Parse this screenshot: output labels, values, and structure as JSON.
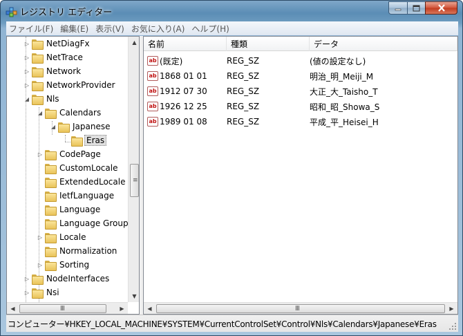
{
  "window": {
    "title": "レジストリ エディター"
  },
  "menu": [
    {
      "label": "ファイル(F)"
    },
    {
      "label": "編集(E)"
    },
    {
      "label": "表示(V)"
    },
    {
      "label": "お気に入り(A)"
    },
    {
      "label": "ヘルプ(H)"
    }
  ],
  "tree": {
    "items": [
      {
        "label": "NetDiagFx",
        "expanded": false
      },
      {
        "label": "NetTrace",
        "expanded": false
      },
      {
        "label": "Network",
        "expanded": false
      },
      {
        "label": "NetworkProvider",
        "expanded": false
      },
      {
        "label": "Nls",
        "expanded": true
      },
      {
        "label": "Calendars",
        "expanded": true
      },
      {
        "label": "Japanese",
        "expanded": true
      },
      {
        "label": "Eras",
        "selected": true
      },
      {
        "label": "CodePage",
        "expanded": false
      },
      {
        "label": "CustomLocale"
      },
      {
        "label": "ExtendedLocale"
      },
      {
        "label": "IetfLanguage"
      },
      {
        "label": "Language"
      },
      {
        "label": "Language Group"
      },
      {
        "label": "Locale",
        "expanded": false
      },
      {
        "label": "Normalization"
      },
      {
        "label": "Sorting",
        "expanded": false
      },
      {
        "label": "NodeInterfaces",
        "expanded": false
      },
      {
        "label": "Nsi",
        "expanded": false
      }
    ]
  },
  "list": {
    "columns": [
      "名前",
      "種類",
      "データ"
    ],
    "rows": [
      {
        "name": "(既定)",
        "type": "REG_SZ",
        "data": "(値の設定なし)"
      },
      {
        "name": "1868 01 01",
        "type": "REG_SZ",
        "data": "明治_明_Meiji_M"
      },
      {
        "name": "1912 07 30",
        "type": "REG_SZ",
        "data": "大正_大_Taisho_T"
      },
      {
        "name": "1926 12 25",
        "type": "REG_SZ",
        "data": "昭和_昭_Showa_S"
      },
      {
        "name": "1989 01 08",
        "type": "REG_SZ",
        "data": "平成_平_Heisei_H"
      }
    ],
    "icon": "string-value-icon"
  },
  "statusbar": {
    "path": "コンピューター¥HKEY_LOCAL_MACHINE¥SYSTEM¥CurrentControlSet¥Control¥Nls¥Calendars¥Japanese¥Eras"
  },
  "icons": {
    "app": "registry-editor-icon",
    "folder": "folder-icon",
    "min": "minimize-icon",
    "max": "maximize-icon",
    "close": "close-icon"
  },
  "colors": {
    "titlebar": "#5b8db5",
    "close_button": "#c13b1f",
    "selection": "#e0e0e0"
  }
}
